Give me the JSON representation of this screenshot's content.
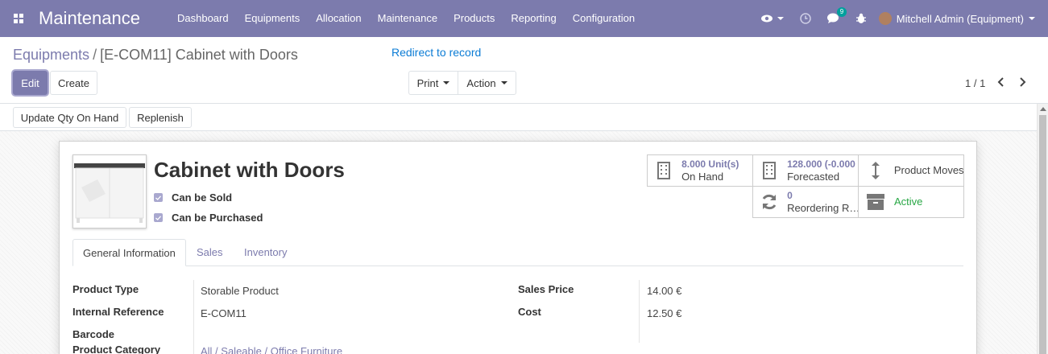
{
  "navbar": {
    "app_name": "Maintenance",
    "menu": [
      "Dashboard",
      "Equipments",
      "Allocation",
      "Maintenance",
      "Products",
      "Reporting",
      "Configuration"
    ],
    "message_count": "9",
    "user": "Mitchell Admin (Equipment)",
    "color": "#7c7bad"
  },
  "control_panel": {
    "breadcrumb_parent": "Equipments",
    "breadcrumb_separator": "/",
    "breadcrumb_current": "[E-COM11] Cabinet with Doors",
    "redirect_link": "Redirect to record",
    "edit_label": "Edit",
    "create_label": "Create",
    "print_label": "Print",
    "action_label": "Action",
    "pager": "1 / 1"
  },
  "statusbar": {
    "update_qty_label": "Update Qty On Hand",
    "replenish_label": "Replenish"
  },
  "product": {
    "name": "Cabinet with Doors",
    "can_be_sold_label": "Can be Sold",
    "can_be_purchased_label": "Can be Purchased",
    "can_be_sold": true,
    "can_be_purchased": true
  },
  "smart_buttons": {
    "on_hand_value": "8.000 Unit(s)",
    "on_hand_label": "On Hand",
    "forecasted_value": "128.000 (-0.000",
    "forecasted_label": "Forecasted",
    "product_moves_label": "Product Moves",
    "reordering_value": "0",
    "reordering_label": "Reordering R…",
    "active_label": "Active",
    "active_color": "#28a745"
  },
  "tabs": [
    "General Information",
    "Sales",
    "Inventory"
  ],
  "fields": {
    "product_type_label": "Product Type",
    "product_type_value": "Storable Product",
    "internal_ref_label": "Internal Reference",
    "internal_ref_value": "E-COM11",
    "barcode_label": "Barcode",
    "barcode_value": "",
    "category_label": "Product Category",
    "category_value": "All / Saleable / Office Furniture",
    "sales_price_label": "Sales Price",
    "sales_price_value": "14.00 €",
    "cost_label": "Cost",
    "cost_value": "12.50 €"
  }
}
